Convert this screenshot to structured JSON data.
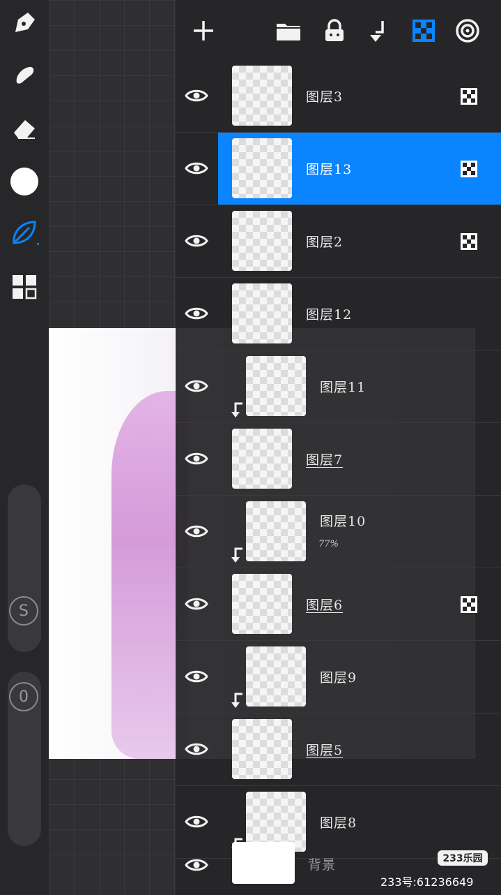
{
  "toolbar": {
    "tools": [
      "pen-icon",
      "smudge-icon",
      "eraser-icon",
      "color-icon",
      "brush-icon",
      "gallery-icon"
    ],
    "size_slider_label": "S",
    "opacity_slider_label": "0"
  },
  "layers_panel": {
    "header_icons": [
      "add-layer-icon",
      "folder-icon",
      "lock-icon",
      "merge-down-icon",
      "checker-icon",
      "target-icon"
    ],
    "layers": [
      {
        "name": "图层3",
        "visible": true,
        "selected": false,
        "clipped": false,
        "underlined": false,
        "blend_icon": true,
        "opacity": ""
      },
      {
        "name": "图层13",
        "visible": true,
        "selected": true,
        "clipped": false,
        "underlined": false,
        "blend_icon": true,
        "opacity": ""
      },
      {
        "name": "图层2",
        "visible": true,
        "selected": false,
        "clipped": false,
        "underlined": false,
        "blend_icon": true,
        "opacity": ""
      },
      {
        "name": "图层12",
        "visible": true,
        "selected": false,
        "clipped": false,
        "underlined": false,
        "blend_icon": false,
        "opacity": ""
      },
      {
        "name": "图层11",
        "visible": true,
        "selected": false,
        "clipped": true,
        "underlined": false,
        "blend_icon": false,
        "opacity": ""
      },
      {
        "name": "图层7",
        "visible": true,
        "selected": false,
        "clipped": false,
        "underlined": true,
        "blend_icon": false,
        "opacity": ""
      },
      {
        "name": "图层10",
        "visible": true,
        "selected": false,
        "clipped": true,
        "underlined": false,
        "blend_icon": false,
        "opacity": "77%"
      },
      {
        "name": "图层6",
        "visible": true,
        "selected": false,
        "clipped": false,
        "underlined": true,
        "blend_icon": true,
        "opacity": ""
      },
      {
        "name": "图层9",
        "visible": true,
        "selected": false,
        "clipped": true,
        "underlined": false,
        "blend_icon": false,
        "opacity": ""
      },
      {
        "name": "图层5",
        "visible": true,
        "selected": false,
        "clipped": false,
        "underlined": true,
        "blend_icon": false,
        "opacity": ""
      },
      {
        "name": "图层8",
        "visible": true,
        "selected": false,
        "clipped": true,
        "underlined": false,
        "blend_icon": false,
        "opacity": ""
      }
    ],
    "background_layer": {
      "name": "背景",
      "visible": true
    }
  },
  "watermark": {
    "logo": "233乐园",
    "id": "233号:61236649"
  },
  "colors": {
    "selected": "#0a84ff",
    "panel": "#262628",
    "toolbar": "#272729"
  }
}
